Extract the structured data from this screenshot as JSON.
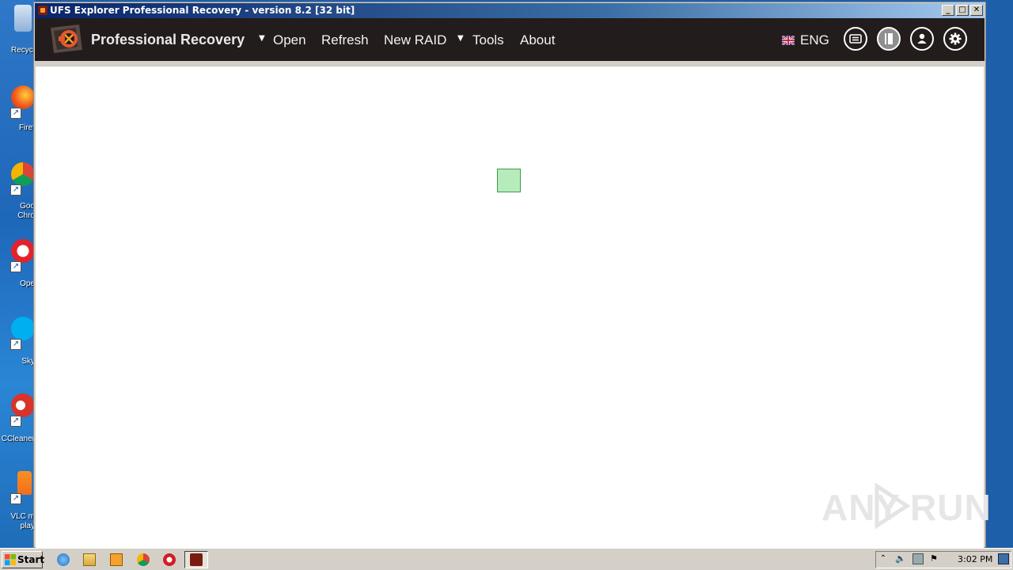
{
  "window": {
    "title": "UFS Explorer Professional Recovery - version 8.2 [32 bit]",
    "min": "_",
    "max": "□",
    "close": "✕"
  },
  "app": {
    "brand": "Professional Recovery",
    "menu": {
      "open": "Open",
      "refresh": "Refresh",
      "new_raid": "New RAID",
      "tools": "Tools",
      "about": "About"
    },
    "language": "ENG"
  },
  "desktop": {
    "icons": [
      {
        "label": "Recycl",
        "icon": "recycle-bin-icon"
      },
      {
        "label": "Firef",
        "icon": "firefox-icon"
      },
      {
        "label": "Goo",
        "label2": "Chro",
        "icon": "chrome-icon"
      },
      {
        "label": "Ope",
        "icon": "opera-icon"
      },
      {
        "label": "Sky",
        "icon": "skype-icon"
      },
      {
        "label": "CCleaner",
        "icon": "ccleaner-icon"
      },
      {
        "label": "VLC m",
        "label2": "play",
        "icon": "vlc-icon"
      }
    ]
  },
  "watermark": {
    "left": "ANY",
    "right": "RUN"
  },
  "taskbar": {
    "start": "Start",
    "clock": "3:02 PM"
  },
  "colors": {
    "header_bg": "#231c1c",
    "title_bar": "#0a246a",
    "accent": "#e4572e"
  }
}
